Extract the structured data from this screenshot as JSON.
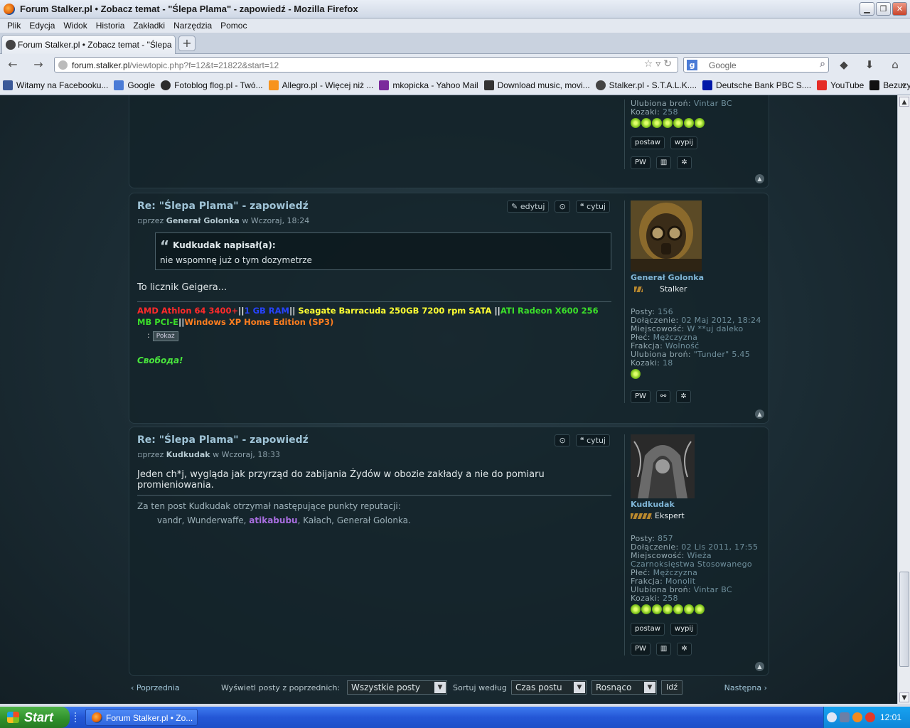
{
  "window": {
    "title": "Forum Stalker.pl • Zobacz temat - \"Ślepa Plama\" - zapowiedź - Mozilla Firefox",
    "min_symbol": "▁",
    "max_symbol": "❐",
    "close_symbol": "✕"
  },
  "menu": [
    "Plik",
    "Edycja",
    "Widok",
    "Historia",
    "Zakładki",
    "Narzędzia",
    "Pomoc"
  ],
  "tab": {
    "label": "Forum Stalker.pl • Zobacz temat - \"Ślepa Pla...",
    "new_tab": "+"
  },
  "nav": {
    "url_host": "forum.stalker.pl",
    "url_path": "/viewtopic.php?f=12&t=21822&start=12",
    "search_placeholder": "Google",
    "back": "←",
    "forward": "→"
  },
  "bookmarks": [
    {
      "label": "Witamy na Facebooku...",
      "color": "#3b5998"
    },
    {
      "label": "Google",
      "color": "#4a7bd6"
    },
    {
      "label": "Fotoblog flog.pl - Twó...",
      "color": "#2b2b2b"
    },
    {
      "label": "Allegro.pl - Więcej niż ...",
      "color": "#f7931e"
    },
    {
      "label": "mkopicka - Yahoo Mail",
      "color": "#7b2a9c"
    },
    {
      "label": "Download music, movi...",
      "color": "#333333"
    },
    {
      "label": "Stalker.pl - S.T.A.L.K....",
      "color": "#444444"
    },
    {
      "label": "Deutsche Bank PBC S....",
      "color": "#0018a8"
    },
    {
      "label": "YouTube",
      "color": "#e52d27"
    },
    {
      "label": "Bezuzyteczna.pl- Cod...",
      "color": "#111111"
    }
  ],
  "bookmarks_more": "»",
  "top_profile": {
    "fav_weapon_label": "Ulubiona broń:",
    "fav_weapon": "Vintar BC",
    "kozaki_label": "Kozaki:",
    "kozaki": "258",
    "btn_postaw": "postaw",
    "btn_wypij": "wypij",
    "btn_pw": "PW"
  },
  "posts": [
    {
      "title": "Re: \"Ślepa Plama\" - zapowiedź",
      "by": "przez",
      "author": "Generał Golonka",
      "when": "w Wczoraj, 18:24",
      "btn_edit": "edytuj",
      "btn_quote": "cytuj",
      "quote_author": "Kudkudak napisał(a):",
      "quote_text": "nie wspomnę już o tym dozymetrze",
      "body": "To licznik Geigera...",
      "sig": {
        "cpu": "AMD Athlon 64 3400+",
        "sep1": "||",
        "ram": "1 GB RAM",
        "sep2": "||",
        "hdd": " Seagate Barracuda 250GB 7200 rpm SATA ",
        "sep3": "||",
        "gpu": "ATI Radeon X600 256 MB PCI-E",
        "sep4": "||",
        "os": "Windows XP Home Edition (SP3)"
      },
      "spoiler_colon": ":",
      "spoiler_btn": "Pokaż",
      "svoboda": "Свобода!",
      "profile": {
        "name": "Generał Golonka",
        "rank": "Stalker",
        "posts_label": "Posty:",
        "posts": "156",
        "joined_label": "Dołączenie:",
        "joined": "02 Maj 2012, 18:24",
        "city_label": "Miejscowość:",
        "city": "W **uj daleko",
        "gender_label": "Płeć:",
        "gender": "Mężczyzna",
        "faction_label": "Frakcja:",
        "faction": "Wolność",
        "weapon_label": "Ulubiona broń:",
        "weapon": "\"Tunder\" 5.45",
        "kozaki_label": "Kozaki:",
        "kozaki": "18",
        "btn_pw": "PW"
      }
    },
    {
      "title": "Re: \"Ślepa Plama\" - zapowiedź",
      "by": "przez",
      "author": "Kudkudak",
      "when": "w Wczoraj, 18:33",
      "btn_quote": "cytuj",
      "body": "Jeden ch*j, wygląda jak przyrząd do zabijania Żydów w obozie zakłady a nie do pomiaru promieniowania.",
      "rep_text": "Za ten post Kudkudak otrzymał następujące punkty reputacji:",
      "rep_before": "vandr, Wunderwaffe, ",
      "rep_highlight": "atikabubu",
      "rep_after": ", Kałach, Generał Golonka.",
      "profile": {
        "name": "Kudkudak",
        "rank": "Ekspert",
        "posts_label": "Posty:",
        "posts": "857",
        "joined_label": "Dołączenie:",
        "joined": "02 Lis 2011, 17:55",
        "city_label": "Miejscowość:",
        "city": "Wieża Czarnoksięstwa Stosowanego",
        "gender_label": "Płeć:",
        "gender": "Mężczyzna",
        "faction_label": "Frakcja:",
        "faction": "Monolit",
        "weapon_label": "Ulubiona broń:",
        "weapon": "Vintar BC",
        "kozaki_label": "Kozaki:",
        "kozaki": "258",
        "btn_postaw": "postaw",
        "btn_wypij": "wypij",
        "btn_pw": "PW"
      }
    }
  ],
  "sortbar": {
    "prev": "‹ Poprzednia",
    "show_label": "Wyświetl posty z poprzednich:",
    "show_value": "Wszystkie posty",
    "sort_label": "Sortuj według",
    "sort_value": "Czas postu",
    "order_value": "Rosnąco",
    "go": "Idź",
    "next": "Następna ›"
  },
  "taskbar": {
    "start": "Start",
    "item": "Forum Stalker.pl • Zo...",
    "clock": "12:01"
  }
}
